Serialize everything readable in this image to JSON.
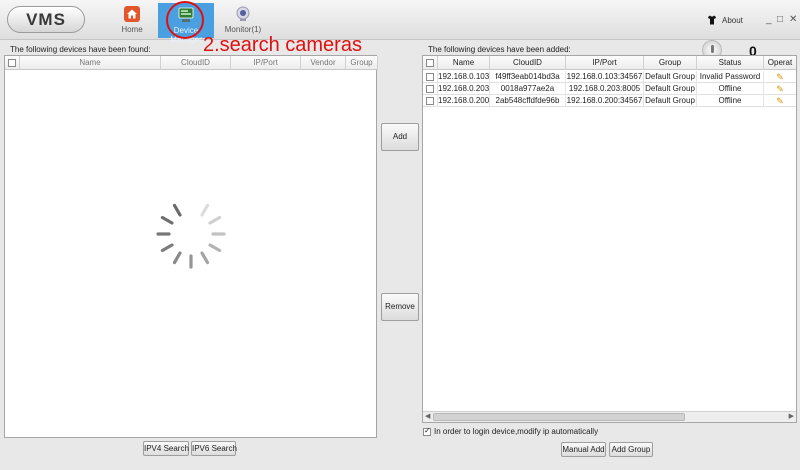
{
  "app": {
    "logo": "VMS",
    "nav": [
      {
        "label": "Home",
        "icon": "home-icon"
      },
      {
        "label": "Device Manager",
        "icon": "device-manager-icon"
      },
      {
        "label": "Monitor(1)",
        "icon": "monitor-icon"
      }
    ],
    "about_label": "About",
    "counter": "0",
    "annotation": "2.search cameras",
    "window_controls": [
      "_",
      "□",
      "✕"
    ]
  },
  "found_panel": {
    "title": "The following devices have been found:",
    "columns": [
      "",
      "Name",
      "CloudID",
      "IP/Port",
      "Vendor",
      "Group"
    ]
  },
  "added_panel": {
    "title": "The following devices have been added:",
    "columns": [
      "",
      "Name",
      "CloudID",
      "IP/Port",
      "Group",
      "Status",
      "Operat"
    ],
    "rows": [
      {
        "name": "192.168.0.103",
        "cloudid": "f49ff3eab014bd3a",
        "ipport": "192.168.0.103:34567",
        "group": "Default Group",
        "status": "Invalid Password"
      },
      {
        "name": "192.168.0.203",
        "cloudid": "0018a977ae2a",
        "ipport": "192.168.0.203:8005",
        "group": "Default Group",
        "status": "Offline"
      },
      {
        "name": "192.168.0.200",
        "cloudid": "2ab548cffdfde96b",
        "ipport": "192.168.0.200:34567",
        "group": "Default Group",
        "status": "Offline"
      }
    ]
  },
  "buttons": {
    "add": "Add",
    "remove": "Remove",
    "ipv4_search": "IPV4 Search",
    "ipv6_search": "IPV6 Search",
    "manual_add": "Manual Add",
    "add_group": "Add Group"
  },
  "auto_modify_label": "In order to login device,modify ip automatically",
  "colors": {
    "accent": "#4a9fe0",
    "annotation": "#e01010",
    "edit_icon": "#d99500"
  }
}
